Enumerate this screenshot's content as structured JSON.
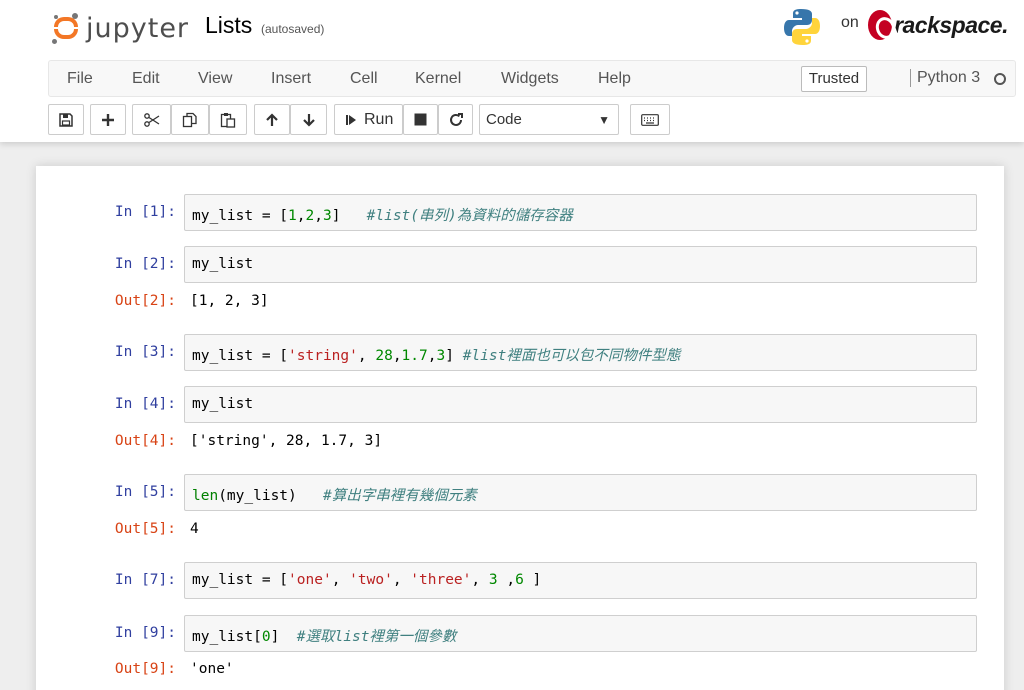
{
  "header": {
    "logo_text": "jupyter",
    "notebook_title": "Lists",
    "autosave_status": "(autosaved)",
    "on_text": "on",
    "host_text": "rackspace."
  },
  "menubar": {
    "items": [
      "File",
      "Edit",
      "View",
      "Insert",
      "Cell",
      "Kernel",
      "Widgets",
      "Help"
    ],
    "trusted_label": "Trusted",
    "kernel_name": "Python 3"
  },
  "toolbar": {
    "run_label": "Run",
    "cell_type": "Code"
  },
  "cells": [
    {
      "in_prompt": "In [1]:",
      "code_parts": [
        "my_list = [",
        "1",
        ",",
        "2",
        ",",
        "3",
        "]   ",
        "#list(串列)為資料的儲存容器"
      ]
    },
    {
      "in_prompt": "In [2]:",
      "code": "my_list",
      "out_prompt": "Out[2]:",
      "output": "[1, 2, 3]"
    },
    {
      "in_prompt": "In [3]:",
      "code_parts": [
        "my_list = [",
        "'string'",
        ", ",
        "28",
        ",",
        "1.7",
        ",",
        "3",
        "] ",
        "#list裡面也可以包不同物件型態"
      ]
    },
    {
      "in_prompt": "In [4]:",
      "code": "my_list",
      "out_prompt": "Out[4]:",
      "output": "['string', 28, 1.7, 3]"
    },
    {
      "in_prompt": "In [5]:",
      "code_parts": [
        "len",
        "(my_list)   ",
        "#算出字串裡有幾個元素"
      ],
      "out_prompt": "Out[5]:",
      "output": "4"
    },
    {
      "in_prompt": "In [7]:",
      "code_parts": [
        "my_list = [",
        "'one'",
        ", ",
        "'two'",
        ", ",
        "'three'",
        ", ",
        "3",
        " ,",
        "6",
        " ]"
      ]
    },
    {
      "in_prompt": "In [9]:",
      "code_parts": [
        "my_list[",
        "0",
        "]  ",
        "#選取list裡第一個參數"
      ],
      "out_prompt": "Out[9]:",
      "output": "'one'"
    }
  ],
  "colors": {
    "jupyter_orange": "#f37726",
    "prompt_in": "#303f9f",
    "prompt_out": "#d84315",
    "syntax_number": "#008800",
    "syntax_string": "#ba2121",
    "syntax_comment": "#408080",
    "rackspace_red": "#c40022"
  }
}
